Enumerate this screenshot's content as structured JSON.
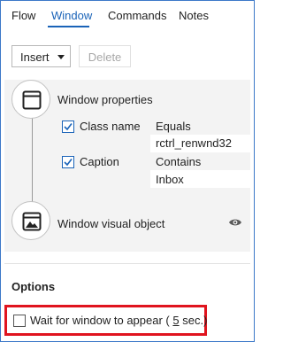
{
  "tabs": [
    {
      "label": "Flow"
    },
    {
      "label": "Window",
      "active": true
    },
    {
      "label": "Commands"
    },
    {
      "label": "Notes"
    }
  ],
  "toolbar": {
    "insert_label": "Insert",
    "delete_label": "Delete",
    "delete_enabled": false
  },
  "steps": {
    "window_properties": {
      "title": "Window properties",
      "icon": "window-icon",
      "properties": [
        {
          "name": "Class name",
          "checked": true,
          "operator": "Equals",
          "value": "rctrl_renwnd32"
        },
        {
          "name": "Caption",
          "checked": true,
          "operator": "Contains",
          "value": "Inbox"
        }
      ]
    },
    "window_visual_object": {
      "title": "Window visual object",
      "icon": "window-image-icon",
      "action_icon": "eye-icon"
    }
  },
  "options": {
    "title": "Options",
    "wait_checked": false,
    "wait_prefix": "Wait for window to appear (",
    "wait_seconds": "5",
    "wait_suffix": " sec.)"
  },
  "colors": {
    "accent": "#1a63b8",
    "highlight": "#e0141e",
    "panel": "#f3f3f3",
    "window_border": "#3c78c8"
  }
}
